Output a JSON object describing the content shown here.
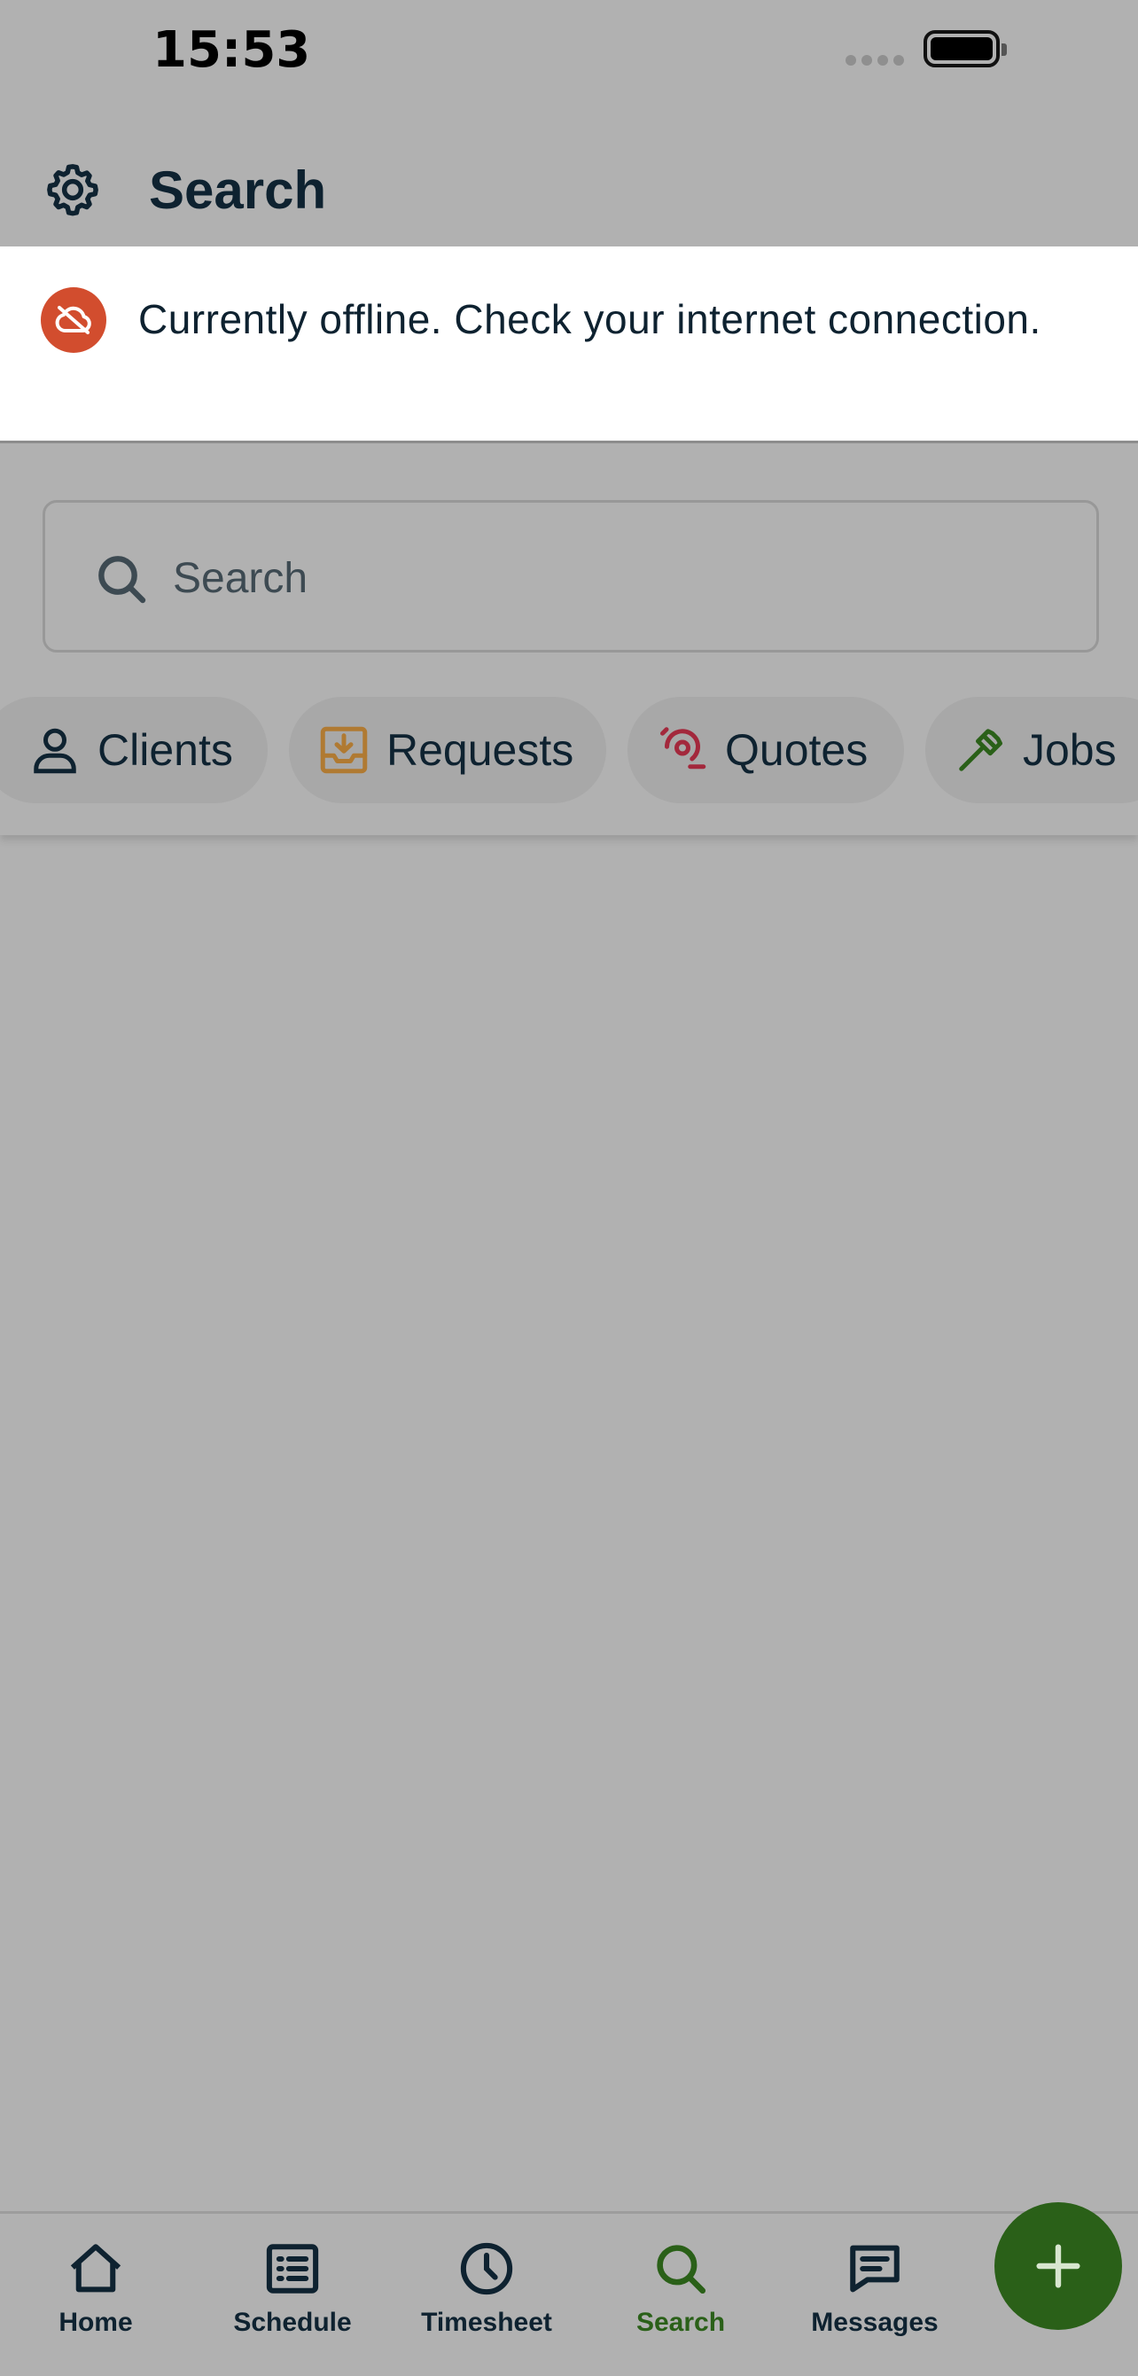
{
  "status_bar": {
    "time": "15:53"
  },
  "header": {
    "title": "Search",
    "settings_icon": "gear-icon"
  },
  "offline_banner": {
    "message": "Currently offline. Check your internet connection.",
    "icon": "cloud-off-icon",
    "color": "#d24d2e"
  },
  "search": {
    "placeholder": "Search",
    "value": ""
  },
  "filters": [
    {
      "label": "Clients",
      "icon": "person-icon",
      "color": "#0e2230"
    },
    {
      "label": "Requests",
      "icon": "inbox-download-icon",
      "color": "#b07a32"
    },
    {
      "label": "Quotes",
      "icon": "quote-icon",
      "color": "#a3283c"
    },
    {
      "label": "Jobs",
      "icon": "hammer-icon",
      "color": "#2a6018"
    }
  ],
  "bottom_nav": {
    "items": [
      {
        "label": "Home",
        "icon": "home-icon"
      },
      {
        "label": "Schedule",
        "icon": "schedule-list-icon"
      },
      {
        "label": "Timesheet",
        "icon": "clock-icon"
      },
      {
        "label": "Search",
        "icon": "search-icon",
        "active": true
      },
      {
        "label": "Messages",
        "icon": "message-icon"
      }
    ]
  },
  "fab": {
    "icon": "plus-icon",
    "color": "#2a6018"
  },
  "colors": {
    "primary_text": "#0e2230",
    "accent_green": "#2a6018",
    "overlay_bg": "#b1b1b1"
  }
}
